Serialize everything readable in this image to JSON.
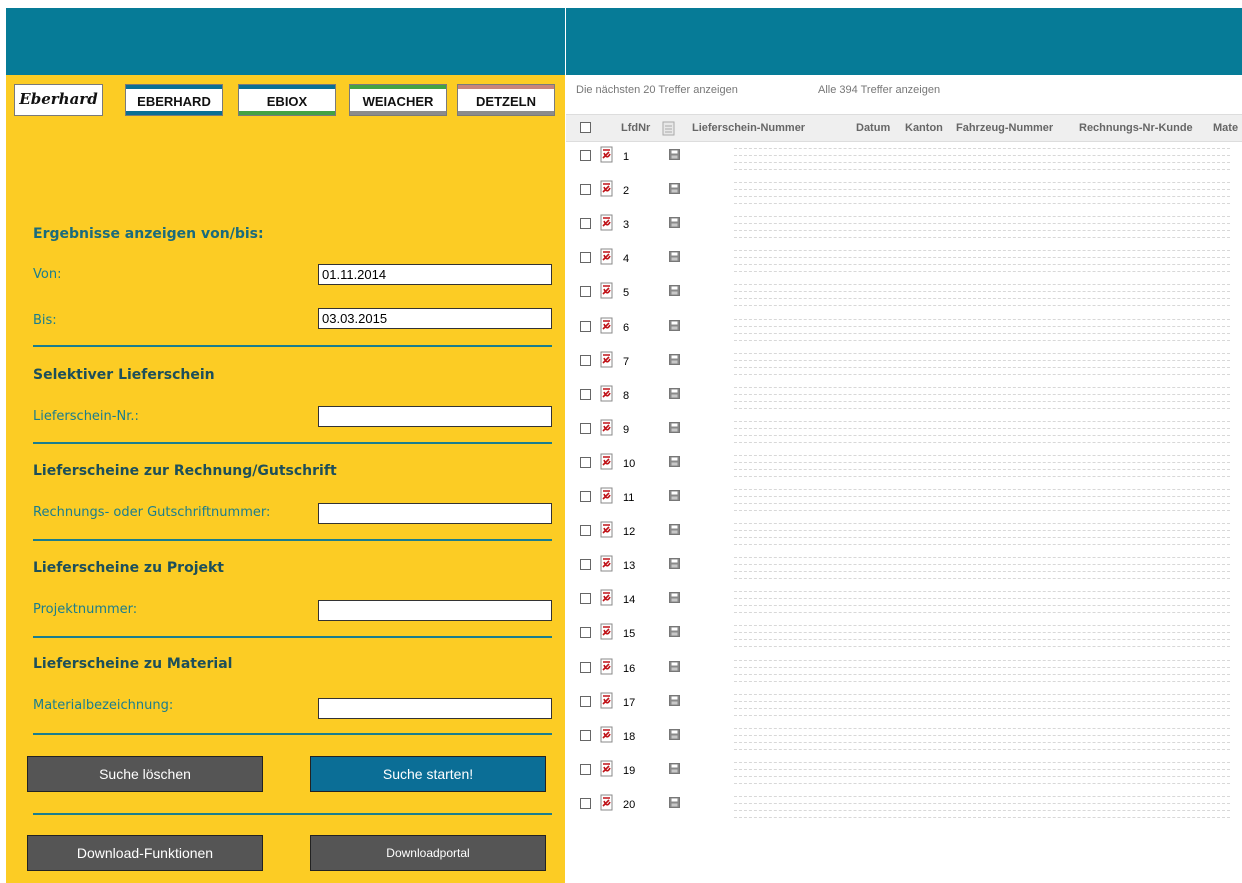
{
  "brands": [
    {
      "label": "Eberhard",
      "style": "logo"
    },
    {
      "label": "EBERHARD",
      "top_color": "#0a6f94",
      "bottom_color": "#0a6f94"
    },
    {
      "label": "EBIOX",
      "top_color": "#0a6f94",
      "bottom_color": "#43a244"
    },
    {
      "label": "WEIACHER",
      "top_color": "#43a244",
      "bottom_color": "#8c8c8c"
    },
    {
      "label": "DETZELN",
      "top_color": "#c9847a",
      "bottom_color": "#8c8c8c"
    }
  ],
  "form": {
    "range_heading": "Ergebnisse anzeigen von/bis:",
    "von_label": "Von:",
    "von_value": "01.11.2014",
    "bis_label": "Bis:",
    "bis_value": "03.03.2015",
    "selective_heading": "Selektiver Lieferschein",
    "lieferschein_label": "Lieferschein-Nr.:",
    "rechnung_heading": "Lieferscheine zur Rechnung/Gutschrift",
    "rechnung_label": "Rechnungs- oder Gutschriftnummer:",
    "projekt_heading": "Lieferscheine zu Projekt",
    "projekt_label": "Projektnummer:",
    "material_heading": "Lieferscheine zu Material",
    "material_label": "Materialbezeichnung:"
  },
  "buttons": {
    "clear": "Suche löschen",
    "start": "Suche starten!",
    "download_functions": "Download-Funktionen",
    "download_portal": "Downloadportal"
  },
  "results": {
    "next_link": "Die nächsten 20 Treffer anzeigen",
    "all_link": "Alle 394 Treffer anzeigen",
    "columns": {
      "lfdnr": "LfdNr",
      "lieferschein": "Lieferschein-Nummer",
      "datum": "Datum",
      "kanton": "Kanton",
      "fahrzeug": "Fahrzeug-Nummer",
      "rechnung": "Rechnungs-Nr-Kunde",
      "material": "Mate"
    },
    "rows": [
      "1",
      "2",
      "3",
      "4",
      "5",
      "6",
      "7",
      "8",
      "9",
      "10",
      "11",
      "12",
      "13",
      "14",
      "15",
      "16",
      "17",
      "18",
      "19",
      "20"
    ]
  },
  "colors": {
    "teal": "#067b97",
    "yellow": "#fccc24",
    "button_grey": "#555555",
    "button_blue": "#0b6e96"
  }
}
